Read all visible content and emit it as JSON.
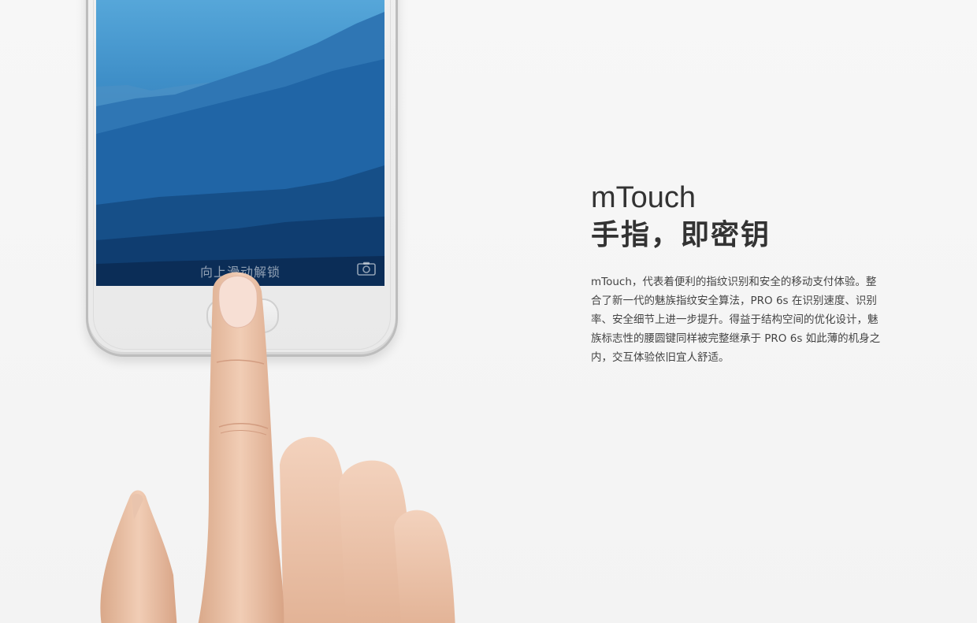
{
  "phone": {
    "unlock_text": "向上滑动解锁",
    "camera_icon": "camera-icon"
  },
  "content": {
    "title_en": "mTouch",
    "title_cn": "手指，即密钥",
    "description": "mTouch，代表着便利的指纹识别和安全的移动支付体验。整合了新一代的魅族指纹安全算法，PRO 6s 在识别速度、识别率、安全细节上进一步提升。得益于结构空间的优化设计，魅族标志性的腰圆键同样被完整继承于 PRO 6s 如此薄的机身之内，交互体验依旧宜人舒适。"
  },
  "colors": {
    "background": "#f5f5f5",
    "screen_sky": "#5aa9dc",
    "screen_deep": "#0b2a55",
    "text": "#333333"
  }
}
